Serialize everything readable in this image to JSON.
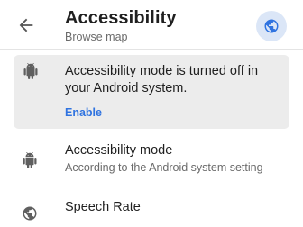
{
  "header": {
    "title": "Accessibility",
    "subtitle": "Browse map",
    "back_icon": "arrow-back-icon",
    "globe_icon": "globe-icon"
  },
  "notice": {
    "icon": "android-icon",
    "message": "Accessibility mode is turned off in your Android system.",
    "action_label": "Enable"
  },
  "settings": [
    {
      "icon": "android-icon",
      "title": "Accessibility mode",
      "subtitle": "According to the Android system setting"
    },
    {
      "icon": "globe-icon",
      "title": "Speech Rate"
    }
  ],
  "colors": {
    "accent": "#2f73e0",
    "globe_badge_bg": "#dbe6f7",
    "card_bg": "#ececec",
    "icon_gray": "#5f5f5f"
  }
}
